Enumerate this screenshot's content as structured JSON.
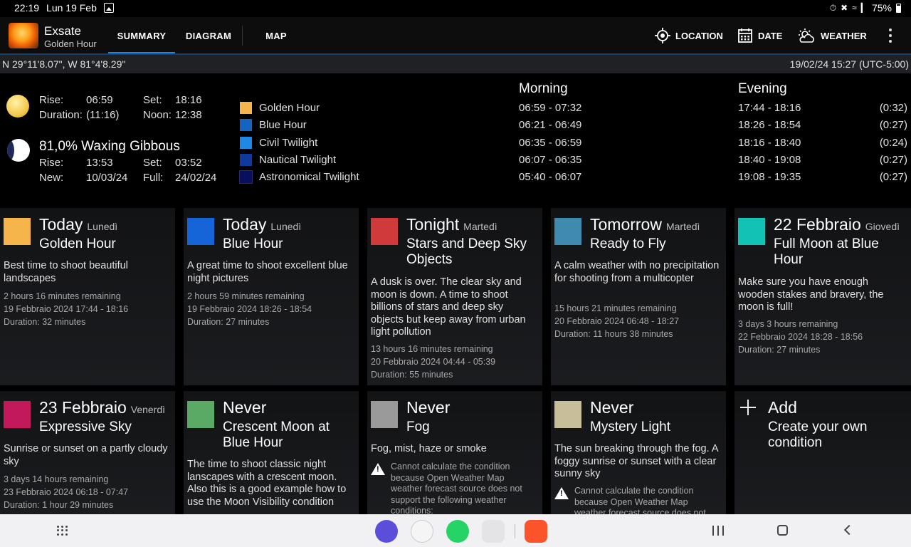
{
  "status_bar": {
    "time": "22:19",
    "date": "Lun 19 Feb",
    "battery": "75%",
    "icons": [
      "gallery-icon",
      "alarm-icon",
      "mute-icon",
      "wifi-icon",
      "signal-icon",
      "battery-icon"
    ]
  },
  "app": {
    "title": "Exsate",
    "subtitle": "Golden Hour"
  },
  "tabs": [
    {
      "label": "SUMMARY",
      "active": true
    },
    {
      "label": "DIAGRAM",
      "active": false
    },
    {
      "label": "MAP",
      "active": false
    }
  ],
  "actions": {
    "location": "LOCATION",
    "date": "DATE",
    "weather": "WEATHER"
  },
  "coord_bar": {
    "coordinates": "N 29°11'8.07\", W 81°4'8.29\"",
    "datetime": "19/02/24 15:27 (UTC-5:00)"
  },
  "sun": {
    "rise_label": "Rise:",
    "rise": "06:59",
    "set_label": "Set:",
    "set": "18:16",
    "duration_label": "Duration:",
    "duration": "(11:16)",
    "noon_label": "Noon:",
    "noon": "12:38"
  },
  "moon": {
    "phase": "81,0% Waxing Gibbous",
    "rise_label": "Rise:",
    "rise": "13:53",
    "set_label": "Set:",
    "set": "03:52",
    "new_label": "New:",
    "new": "10/03/24",
    "full_label": "Full:",
    "full": "24/02/24"
  },
  "legend": [
    {
      "label": "Golden Hour",
      "color": "#f6b54a"
    },
    {
      "label": "Blue Hour",
      "color": "#1565c0"
    },
    {
      "label": "Civil Twilight",
      "color": "#1e88e5"
    },
    {
      "label": "Nautical Twilight",
      "color": "#0d3a9c"
    },
    {
      "label": "Astronomical Twilight",
      "color": "#08105e"
    }
  ],
  "schedule": {
    "morning_label": "Morning",
    "evening_label": "Evening",
    "morning": [
      "06:59 - 07:32",
      "06:21 - 06:49",
      "06:35 - 06:59",
      "06:07 - 06:35",
      "05:40 - 06:07"
    ],
    "evening": [
      "17:44 - 18:16",
      "18:26 - 18:54",
      "18:16 - 18:40",
      "18:40 - 19:08",
      "19:08 - 19:35"
    ],
    "evening_durations": [
      "(0:32)",
      "(0:27)",
      "(0:24)",
      "(0:27)",
      "(0:27)"
    ]
  },
  "cards": [
    {
      "when": "Today",
      "day": "Lunedì",
      "title": "Golden Hour",
      "color": "#f6b54a",
      "description": "Best time to shoot beautiful landscapes",
      "remaining": "2 hours 16 minutes remaining",
      "range": "19 Febbraio 2024 17:44 - 18:16",
      "duration": "Duration: 32 minutes"
    },
    {
      "when": "Today",
      "day": "Lunedì",
      "title": "Blue Hour",
      "color": "#1565d8",
      "description": "A great time to shoot excellent blue night pictures",
      "remaining": "2 hours 59 minutes remaining",
      "range": "19 Febbraio 2024 18:26 - 18:54",
      "duration": "Duration: 27 minutes"
    },
    {
      "when": "Tonight",
      "day": "Martedì",
      "title": "Stars and Deep Sky Objects",
      "color": "#d03a3a",
      "description": "A dusk is over. The clear sky and moon is down. A time to shoot billions of stars and deep sky objects but keep away from urban light pollution",
      "remaining": "13 hours 16 minutes remaining",
      "range": "20 Febbraio 2024 04:44 - 05:39",
      "duration": "Duration: 55 minutes"
    },
    {
      "when": "Tomorrow",
      "day": "Martedì",
      "title": "Ready to Fly",
      "color": "#3f8bb0",
      "description": "A calm weather with no precipitation for shooting from a multicopter",
      "remaining": "15 hours 21 minutes remaining",
      "range": "20 Febbraio 2024 06:48 - 18:27",
      "duration": "Duration: 11 hours 38 minutes"
    },
    {
      "when": "22 Febbraio",
      "day": "Giovedì",
      "title": "Full Moon at Blue Hour",
      "color": "#12c2b4",
      "description": "Make sure you have enough wooden stakes and bravery, the moon is full!",
      "remaining": "3 days 3 hours remaining",
      "range": "22 Febbraio 2024 18:28 - 18:56",
      "duration": "Duration: 27 minutes"
    },
    {
      "when": "23 Febbraio",
      "day": "Venerdì",
      "title": "Expressive Sky",
      "color": "#c2195a",
      "description": "Sunrise or sunset on a partly cloudy sky",
      "remaining": "3 days 14 hours remaining",
      "range": "23 Febbraio 2024 06:18 - 07:47",
      "duration": "Duration: 1 hour 29 minutes"
    },
    {
      "when": "Never",
      "day": "",
      "title": "Crescent Moon at Blue Hour",
      "color": "#5aaa66",
      "description": "The time to shoot classic night lanscapes with a crescent moon. Also this is a good example how to use the Moon Visibility condition"
    },
    {
      "when": "Never",
      "day": "",
      "title": "Fog",
      "color": "#9a9a9a",
      "description": "Fog, mist, haze or smoke",
      "warning": "Cannot calculate the condition because Open Weather Map weather forecast source does not support the following weather conditions:"
    },
    {
      "when": "Never",
      "day": "",
      "title": "Mystery Light",
      "color": "#c8bf9a",
      "description": "The sun breaking through the fog. A foggy sunrise or sunset with a clear sunny sky",
      "warning": "Cannot calculate the condition because Open Weather Map weather forecast source does not support the following weather conditions:"
    }
  ],
  "add_card": {
    "label": "Add",
    "subtitle": "Create your own condition"
  },
  "dock": [
    {
      "name": "samsung-internet-icon",
      "color": "#5b4fd9"
    },
    {
      "name": "shield-app-icon",
      "color": "#f5f5f5"
    },
    {
      "name": "whatsapp-icon",
      "color": "#25d366"
    },
    {
      "name": "app-folder-icon",
      "color": "#e4e4e6"
    },
    {
      "name": "brave-icon",
      "color": "#fb542b"
    }
  ]
}
